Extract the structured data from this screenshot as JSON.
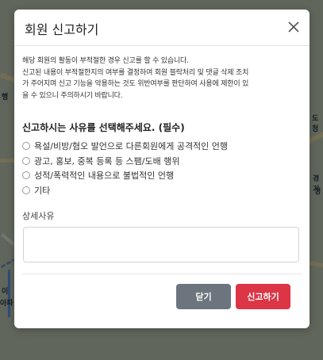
{
  "map": {
    "labels": [
      "행",
      "도청",
      "경기",
      "제",
      "청",
      "이",
      "아파"
    ]
  },
  "modal": {
    "title": "회원 신고하기",
    "notice_lines": [
      "해당 회원의 활동이 부적절한 경우 신고를 할 수 있습니다.",
      "신고된 내용이 부적절한지의 여부를 결정하여 회원 블락처리 및 댓글 삭제 조치",
      "가 주어지며 신고 기능을 악용하는 것도 위반여부를 판단하여 사용에 제한이 있",
      "을 수 있으니 주의하시기 바랍니다."
    ],
    "question": "신고하시는 사유를 선택해주세요. (필수)",
    "options": [
      "욕설/비방/혐오 발언으로 다른회원에게 공격적인 언행",
      "광고, 홍보, 중복 등록 등 스팸/도배 행위",
      "성적/폭력적인 내용으로 불법적인 언행",
      "기타"
    ],
    "detail_label": "상세사유",
    "detail_value": "",
    "detail_placeholder": "",
    "close_label": "닫기",
    "report_label": "신고하기"
  },
  "colors": {
    "close_button": "#6c757d",
    "report_button": "#dc3545"
  }
}
